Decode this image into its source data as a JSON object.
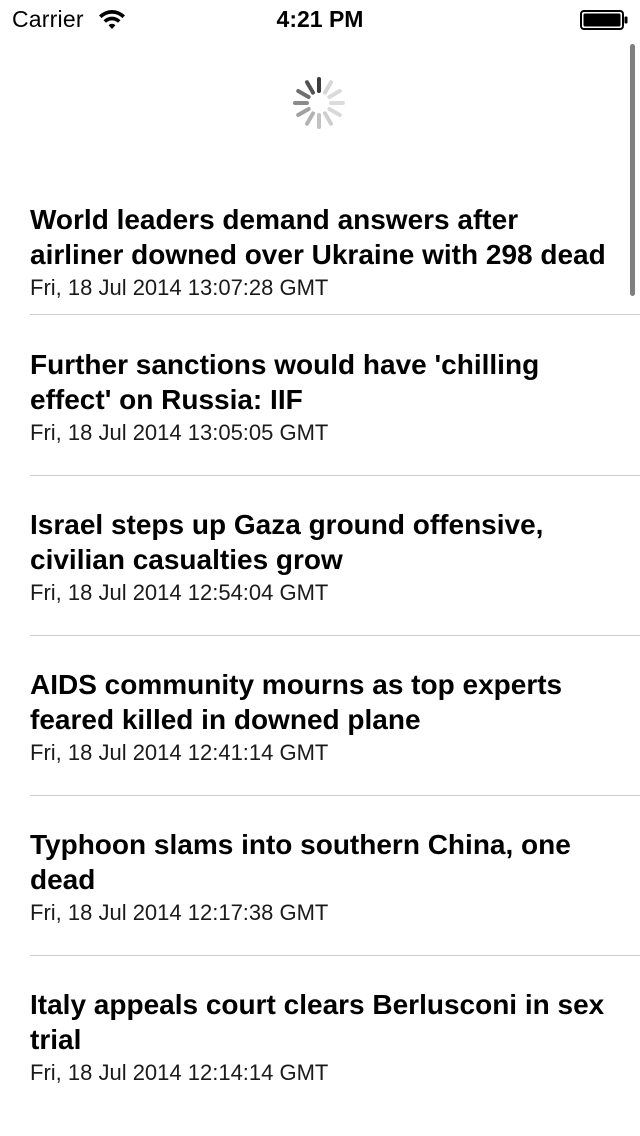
{
  "status_bar": {
    "carrier": "Carrier",
    "time": "4:21 PM"
  },
  "news": [
    {
      "headline": "World leaders demand answers after airliner downed over Ukraine with 298 dead",
      "date": "Fri, 18 Jul 2014 13:07:28 GMT"
    },
    {
      "headline": "Further sanctions would have 'chilling effect' on Russia: IIF",
      "date": "Fri, 18 Jul 2014 13:05:05 GMT"
    },
    {
      "headline": "Israel steps up Gaza ground offensive, civilian casualties grow",
      "date": "Fri, 18 Jul 2014 12:54:04 GMT"
    },
    {
      "headline": "AIDS community mourns as top experts feared killed in downed plane",
      "date": "Fri, 18 Jul 2014 12:41:14 GMT"
    },
    {
      "headline": "Typhoon slams into southern China, one dead",
      "date": "Fri, 18 Jul 2014 12:17:38 GMT"
    },
    {
      "headline": "Italy appeals court clears Berlusconi in sex trial",
      "date": "Fri, 18 Jul 2014 12:14:14 GMT"
    }
  ],
  "icons": {
    "wifi": "wifi-icon",
    "battery": "battery-icon",
    "spinner": "activity-spinner-icon"
  }
}
